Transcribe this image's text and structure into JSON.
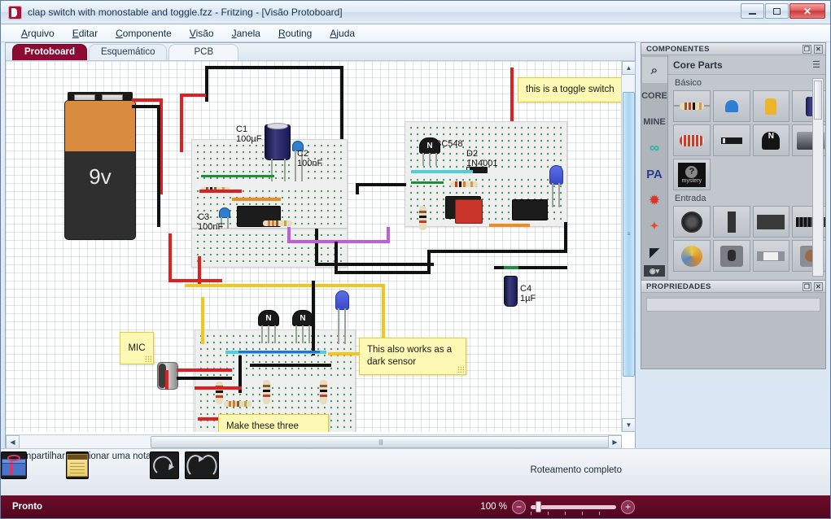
{
  "window": {
    "title": "clap switch with monostable and toggle.fzz - Fritzing - [Visão Protoboard]",
    "minimize": "—",
    "maximize": "□",
    "close": "✕"
  },
  "menu": [
    {
      "label": "Arquivo"
    },
    {
      "label": "Editar"
    },
    {
      "label": "Componente"
    },
    {
      "label": "Visão"
    },
    {
      "label": "Janela"
    },
    {
      "label": "Routing"
    },
    {
      "label": "Ajuda"
    }
  ],
  "tabs": [
    {
      "label": "Protoboard",
      "active": true
    },
    {
      "label": "Esquemático",
      "active": false
    },
    {
      "label": "PCB",
      "active": false
    }
  ],
  "canvas": {
    "battery_label": "9v",
    "notes": [
      {
        "id": "toggle",
        "text": "this is a toggle switch"
      },
      {
        "id": "dark",
        "text": "This also works as a\ndark sensor"
      },
      {
        "id": "modules",
        "text": "Make these three\nmodules separately\nand combine them to"
      },
      {
        "id": "mic",
        "text": "MIC"
      }
    ],
    "part_labels": [
      {
        "id": "c1",
        "text": "C1\n100µF"
      },
      {
        "id": "c2",
        "text": "C2\n100nF"
      },
      {
        "id": "c3",
        "text": "C3\n100nF"
      },
      {
        "id": "c4",
        "text": "C4\n1µF"
      },
      {
        "id": "q1",
        "text": "BC548"
      },
      {
        "id": "d2",
        "text": "D2\n1N4001"
      }
    ]
  },
  "components_dock": {
    "title": "COMPONENTES",
    "parts_title": "Core Parts",
    "bins": [
      {
        "label": "🔍",
        "name": "search"
      },
      {
        "label": "CORE",
        "name": "core"
      },
      {
        "label": "MINE",
        "name": "mine"
      },
      {
        "label": "∞",
        "name": "arduino"
      },
      {
        "label": "PA",
        "name": "parallax"
      },
      {
        "label": "✺",
        "name": "sparkfun"
      },
      {
        "label": "✦",
        "name": "snootlab"
      },
      {
        "label": "◣",
        "name": "seeed"
      }
    ],
    "sections": [
      {
        "label": "Básico",
        "items": [
          {
            "name": "resistor"
          },
          {
            "name": "capacitor-ceramic"
          },
          {
            "name": "capacitor-film"
          },
          {
            "name": "capacitor-electrolytic"
          },
          {
            "name": "inductor"
          },
          {
            "name": "diode"
          },
          {
            "name": "transistor"
          },
          {
            "name": "ic"
          },
          {
            "name": "mystery-part",
            "caption": "mystery"
          }
        ]
      },
      {
        "label": "Entrada",
        "items": [
          {
            "name": "microphone"
          },
          {
            "name": "slide-switch"
          },
          {
            "name": "module"
          },
          {
            "name": "pin-header"
          },
          {
            "name": "rotary-knob"
          },
          {
            "name": "rotary-switch"
          },
          {
            "name": "fuse"
          },
          {
            "name": "pushbutton"
          }
        ]
      }
    ]
  },
  "properties_dock": {
    "title": "PROPRIEDADES"
  },
  "toolbar": [
    {
      "label": "Compartilhar",
      "icon": "gift-icon",
      "disabled": false
    },
    {
      "label": "Adicionar uma nota",
      "icon": "note-icon",
      "disabled": false
    },
    {
      "label": "Girar",
      "icon": "rotate-icon",
      "disabled": true
    },
    {
      "label": "Inverter",
      "icon": "flip-icon",
      "disabled": true
    }
  ],
  "routing_status": "Roteamento completo",
  "statusbar": {
    "status": "Pronto",
    "zoom": "100 %",
    "zoom_out": "−",
    "zoom_in": "+"
  }
}
